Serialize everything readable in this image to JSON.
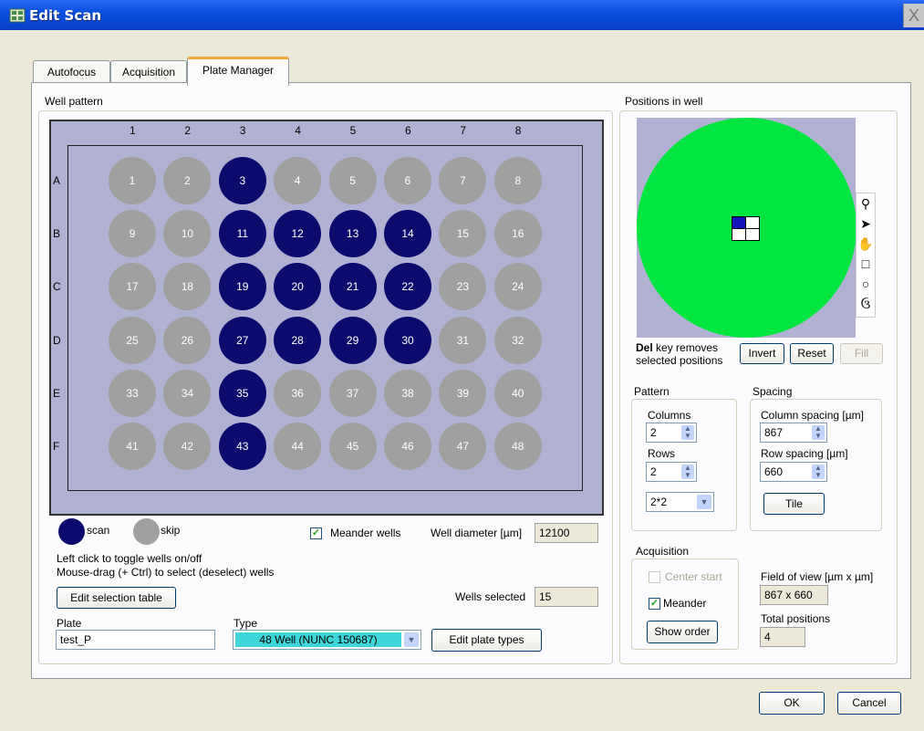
{
  "window": {
    "title": "Edit Scan",
    "close": "X"
  },
  "tabs": [
    {
      "label": "Autofocus"
    },
    {
      "label": "Acquisition"
    },
    {
      "label": "Plate Manager"
    }
  ],
  "well_pattern": {
    "title": "Well pattern",
    "columns": [
      "1",
      "2",
      "3",
      "4",
      "5",
      "6",
      "7",
      "8"
    ],
    "rows": [
      "A",
      "B",
      "C",
      "D",
      "E",
      "F"
    ],
    "wells": [
      {
        "n": "1",
        "sel": false
      },
      {
        "n": "2",
        "sel": false
      },
      {
        "n": "3",
        "sel": true
      },
      {
        "n": "4",
        "sel": false
      },
      {
        "n": "5",
        "sel": false
      },
      {
        "n": "6",
        "sel": false
      },
      {
        "n": "7",
        "sel": false
      },
      {
        "n": "8",
        "sel": false
      },
      {
        "n": "9",
        "sel": false
      },
      {
        "n": "10",
        "sel": false
      },
      {
        "n": "11",
        "sel": true
      },
      {
        "n": "12",
        "sel": true
      },
      {
        "n": "13",
        "sel": true
      },
      {
        "n": "14",
        "sel": true
      },
      {
        "n": "15",
        "sel": false
      },
      {
        "n": "16",
        "sel": false
      },
      {
        "n": "17",
        "sel": false
      },
      {
        "n": "18",
        "sel": false
      },
      {
        "n": "19",
        "sel": true
      },
      {
        "n": "20",
        "sel": true
      },
      {
        "n": "21",
        "sel": true
      },
      {
        "n": "22",
        "sel": true
      },
      {
        "n": "23",
        "sel": false
      },
      {
        "n": "24",
        "sel": false
      },
      {
        "n": "25",
        "sel": false
      },
      {
        "n": "26",
        "sel": false
      },
      {
        "n": "27",
        "sel": true
      },
      {
        "n": "28",
        "sel": true
      },
      {
        "n": "29",
        "sel": true
      },
      {
        "n": "30",
        "sel": true
      },
      {
        "n": "31",
        "sel": false
      },
      {
        "n": "32",
        "sel": false
      },
      {
        "n": "33",
        "sel": false
      },
      {
        "n": "34",
        "sel": false
      },
      {
        "n": "35",
        "sel": true
      },
      {
        "n": "36",
        "sel": false
      },
      {
        "n": "37",
        "sel": false
      },
      {
        "n": "38",
        "sel": false
      },
      {
        "n": "39",
        "sel": false
      },
      {
        "n": "40",
        "sel": false
      },
      {
        "n": "41",
        "sel": false
      },
      {
        "n": "42",
        "sel": false
      },
      {
        "n": "43",
        "sel": true
      },
      {
        "n": "44",
        "sel": false
      },
      {
        "n": "45",
        "sel": false
      },
      {
        "n": "46",
        "sel": false
      },
      {
        "n": "47",
        "sel": false
      },
      {
        "n": "48",
        "sel": false
      }
    ],
    "legend_scan": "scan",
    "legend_skip": "skip",
    "meander_label": "Meander wells",
    "meander_checked": true,
    "well_diameter_label": "Well diameter [µm]",
    "well_diameter_value": "12100",
    "hint1": "Left click to toggle wells on/off",
    "hint2": "Mouse-drag (+ Ctrl)  to select (deselect) wells",
    "edit_selection_button": "Edit selection table",
    "wells_selected_label": "Wells selected",
    "wells_selected_value": "15",
    "plate_label": "Plate",
    "plate_value": "test_P",
    "type_label": "Type",
    "type_value": "48 Well (NUNC 150687)",
    "edit_plate_types_button": "Edit plate types"
  },
  "positions": {
    "title": "Positions in well",
    "del_key": "Del",
    "del_hint1": " key removes",
    "del_hint2": "selected positions",
    "invert_button": "Invert",
    "reset_button": "Reset",
    "fill_button": "Fill",
    "pattern_title": "Pattern",
    "columns_label": "Columns",
    "columns_value": "2",
    "rows_label": "Rows",
    "rows_value": "2",
    "pattern_select": "2*2",
    "spacing_title": "Spacing",
    "col_spacing_label": "Column spacing [µm]",
    "col_spacing_value": "867",
    "row_spacing_label": "Row spacing [µm]",
    "row_spacing_value": "660",
    "tile_button": "Tile",
    "acq_title": "Acquisition",
    "center_start_label": "Center start",
    "meander_label": "Meander",
    "show_order_button": "Show order",
    "fov_label": "Field of view [µm x µm]",
    "fov_value": "867 x 660",
    "total_label": "Total positions",
    "total_value": "4"
  },
  "footer": {
    "ok": "OK",
    "cancel": "Cancel"
  },
  "colors": {
    "selected_well": "#0b0b6e",
    "skipped_well": "#a0a0a0",
    "plate_bg": "#b1b1d3",
    "well_view": "#00e640",
    "type_bg": "#3fd6d9"
  }
}
